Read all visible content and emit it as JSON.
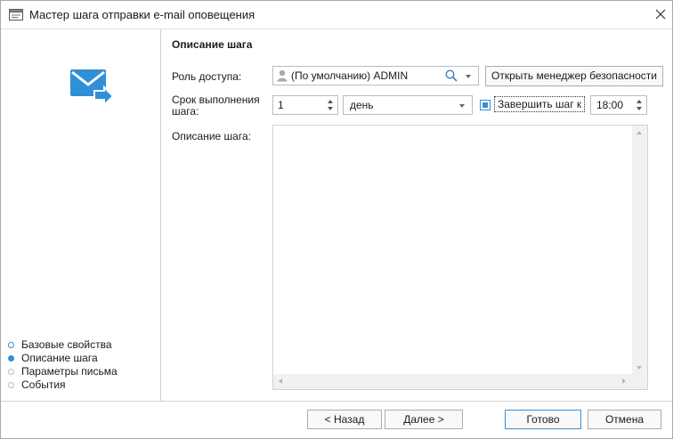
{
  "window": {
    "title": "Мастер шага отправки e-mail оповещения"
  },
  "sidebar": {
    "steps": [
      {
        "label": "Базовые свойства",
        "state": "done"
      },
      {
        "label": "Описание шага",
        "state": "current"
      },
      {
        "label": "Параметры письма",
        "state": "pending"
      },
      {
        "label": "События",
        "state": "pending"
      }
    ]
  },
  "main": {
    "section_title": "Описание шага",
    "role_label": "Роль доступа:",
    "role_value": "(По умолчанию) ADMIN",
    "security_manager_button": "Открыть менеджер безопасности",
    "deadline_label_line1": "Срок выполнения",
    "deadline_label_line2": "шага:",
    "deadline_value": "1",
    "deadline_unit": "день",
    "finish_by_checkbox_label": "Завершить шаг к",
    "finish_by_checked": true,
    "finish_time": "18:00",
    "description_label": "Описание шага:",
    "description_value": ""
  },
  "footer": {
    "back_button": "< Назад",
    "next_button": "Далее >",
    "done_button": "Готово",
    "cancel_button": "Отмена"
  },
  "colors": {
    "accent": "#2f8fd8",
    "border": "#bcbcbc"
  },
  "icons": {
    "app": "window-icon",
    "close": "close-icon",
    "wizard": "mail-send-icon",
    "user": "user-icon",
    "search": "search-icon"
  }
}
